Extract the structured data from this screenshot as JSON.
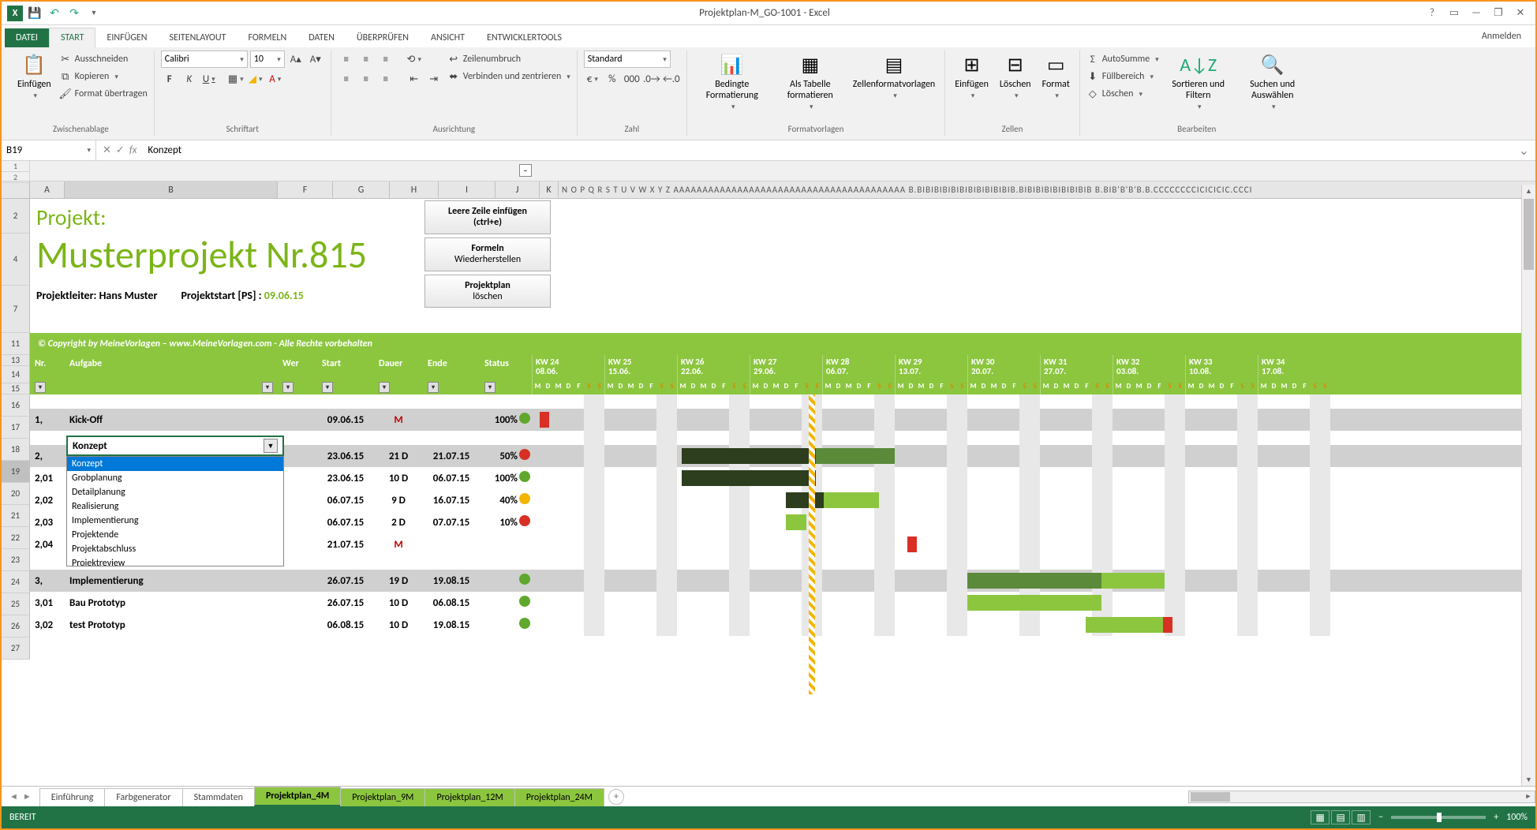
{
  "app": {
    "title": "Projektplan-M_GO-1001 - Excel",
    "signin": "Anmelden"
  },
  "qat": {
    "save": "💾",
    "undo": "↶",
    "redo": "↷"
  },
  "tabs": {
    "file": "DATEI",
    "start": "START",
    "einfuegen": "EINFÜGEN",
    "seitenlayout": "SEITENLAYOUT",
    "formeln": "FORMELN",
    "daten": "DATEN",
    "ueberpruefen": "ÜBERPRÜFEN",
    "ansicht": "ANSICHT",
    "devtools": "ENTWICKLERTOOLS"
  },
  "ribbon": {
    "clipboard": {
      "label": "Zwischenablage",
      "paste": "Einfügen",
      "cut": "Ausschneiden",
      "copy": "Kopieren",
      "fmtpaint": "Format übertragen"
    },
    "font": {
      "label": "Schriftart",
      "name": "Calibri",
      "size": "10",
      "bold": "F",
      "italic": "K",
      "underline": "U"
    },
    "align": {
      "label": "Ausrichtung",
      "wrap": "Zeilenumbruch",
      "merge": "Verbinden und zentrieren"
    },
    "number": {
      "label": "Zahl",
      "format": "Standard"
    },
    "styles": {
      "label": "Formatvorlagen",
      "cond": "Bedingte Formatierung",
      "table": "Als Tabelle formatieren",
      "cell": "Zellenformatvorlagen"
    },
    "cells": {
      "label": "Zellen",
      "insert": "Einfügen",
      "delete": "Löschen",
      "format": "Format"
    },
    "editing": {
      "label": "Bearbeiten",
      "sum": "AutoSumme",
      "fill": "Füllbereich",
      "clear": "Löschen",
      "sort": "Sortieren und Filtern",
      "find": "Suchen und Auswählen"
    }
  },
  "formula": {
    "cellref": "B19",
    "value": "Konzept"
  },
  "columns": [
    "A",
    "B",
    "F",
    "G",
    "H",
    "I",
    "J",
    "K"
  ],
  "project": {
    "label": "Projekt:",
    "name": "Musterprojekt Nr.815",
    "leader_lbl": "Projektleiter: Hans Muster",
    "start_lbl": "Projektstart [PS] :",
    "start_date": "09.06.15",
    "btn1a": "Leere Zeile einfügen",
    "btn1b": "(ctrl+e)",
    "btn2a": "Formeln",
    "btn2b": "Wiederherstellen",
    "btn3a": "Projektplan",
    "btn3b": "löschen",
    "copyright": "© Copyright by MeineVorlagen – www.MeineVorlagen.com - Alle Rechte vorbehalten"
  },
  "headers": {
    "nr": "Nr.",
    "task": "Aufgabe",
    "wer": "Wer",
    "start": "Start",
    "dauer": "Dauer",
    "ende": "Ende",
    "status": "Status"
  },
  "weeks": [
    {
      "kw": "KW 24",
      "d": "08.06."
    },
    {
      "kw": "KW 25",
      "d": "15.06."
    },
    {
      "kw": "KW 26",
      "d": "22.06."
    },
    {
      "kw": "KW 27",
      "d": "29.06."
    },
    {
      "kw": "KW 28",
      "d": "06.07."
    },
    {
      "kw": "KW 29",
      "d": "13.07."
    },
    {
      "kw": "KW 30",
      "d": "20.07."
    },
    {
      "kw": "KW 31",
      "d": "27.07."
    },
    {
      "kw": "KW 32",
      "d": "03.08."
    },
    {
      "kw": "KW 33",
      "d": "10.08."
    },
    {
      "kw": "KW 34",
      "d": "17.08."
    }
  ],
  "days": [
    "M",
    "D",
    "M",
    "D",
    "F",
    "S",
    "S"
  ],
  "tasks": [
    {
      "row": "17",
      "nr": "1,",
      "name": "Kick-Off",
      "start": "09.06.15",
      "dauer": "M",
      "dtype": "m",
      "ende": "",
      "status": "100%",
      "ic": "green",
      "group": true
    },
    {
      "row": "19",
      "nr": "2,",
      "name": "Konzept",
      "start": "23.06.15",
      "dauer": "21 D",
      "dtype": "d",
      "ende": "21.07.15",
      "status": "50%",
      "ic": "red",
      "group": true,
      "sel": true
    },
    {
      "row": "20",
      "nr": "2,01",
      "name": "",
      "start": "23.06.15",
      "dauer": "10 D",
      "dtype": "d",
      "ende": "06.07.15",
      "status": "100%",
      "ic": "green"
    },
    {
      "row": "21",
      "nr": "2,02",
      "name": "",
      "start": "06.07.15",
      "dauer": "9 D",
      "dtype": "d",
      "ende": "16.07.15",
      "status": "40%",
      "ic": "yellow"
    },
    {
      "row": "22",
      "nr": "2,03",
      "name": "",
      "start": "06.07.15",
      "dauer": "2 D",
      "dtype": "d",
      "ende": "07.07.15",
      "status": "10%",
      "ic": "red"
    },
    {
      "row": "23",
      "nr": "2,04",
      "name": "",
      "start": "21.07.15",
      "dauer": "M",
      "dtype": "m",
      "ende": "",
      "status": "",
      "ic": ""
    },
    {
      "row": "25",
      "nr": "3,",
      "name": "Implementierung",
      "start": "26.07.15",
      "dauer": "19 D",
      "dtype": "d",
      "ende": "19.08.15",
      "status": "",
      "ic": "green",
      "group": true
    },
    {
      "row": "26",
      "nr": "3,01",
      "name": "Bau Prototyp",
      "start": "26.07.15",
      "dauer": "10 D",
      "dtype": "d",
      "ende": "06.08.15",
      "status": "",
      "ic": "green"
    },
    {
      "row": "27",
      "nr": "3,02",
      "name": "test Prototyp",
      "start": "06.08.15",
      "dauer": "10 D",
      "dtype": "d",
      "ende": "19.08.15",
      "status": "",
      "ic": "green"
    }
  ],
  "dropdown": {
    "selected": "Konzept",
    "options": [
      "Konzept",
      "Grobplanung",
      "Detailplanung",
      "Realisierung",
      "Implementierung",
      "Projektende",
      "Projektabschluss",
      "Projektreview"
    ]
  },
  "sheets": {
    "nav_first": "◄",
    "nav_last": "►",
    "tabs": [
      {
        "name": "Einführung",
        "cls": ""
      },
      {
        "name": "Farbgenerator",
        "cls": ""
      },
      {
        "name": "Stammdaten",
        "cls": ""
      },
      {
        "name": "Projektplan_4M",
        "cls": "active"
      },
      {
        "name": "Projektplan_9M",
        "cls": "green"
      },
      {
        "name": "Projektplan_12M",
        "cls": "green"
      },
      {
        "name": "Projektplan_24M",
        "cls": "green"
      }
    ]
  },
  "status": {
    "ready": "BEREIT",
    "zoom": "100%"
  },
  "rownums": [
    "2",
    "4",
    "7",
    "11",
    "13",
    "14",
    "15",
    "16",
    "17",
    "18",
    "19",
    "20",
    "21",
    "22",
    "23",
    "24",
    "25",
    "26",
    "27"
  ],
  "colrest": "N O P Q R S T U V W X Y Z AAAAAAAAAAAAAAAAAAAAAAAAAAAAAAAAAAAAAAAA B.BIBIBIBIBIBIBIBIBIBIBIB.BIBIBIBIBIBIBIBIB B.BIB'B'B'B.B.CCCCCCCCICICICIC.CCCI"
}
